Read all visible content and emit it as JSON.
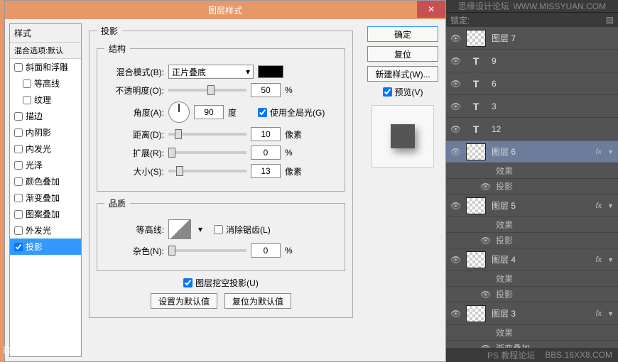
{
  "dialog": {
    "title": "图层样式",
    "close": "✕",
    "styles": {
      "header": "样式",
      "sub": "混合选项:默认",
      "items": [
        {
          "label": "斜面和浮雕",
          "checked": false,
          "indent": false
        },
        {
          "label": "等高线",
          "checked": false,
          "indent": true
        },
        {
          "label": "纹理",
          "checked": false,
          "indent": true
        },
        {
          "label": "描边",
          "checked": false,
          "indent": false
        },
        {
          "label": "内阴影",
          "checked": false,
          "indent": false
        },
        {
          "label": "内发光",
          "checked": false,
          "indent": false
        },
        {
          "label": "光泽",
          "checked": false,
          "indent": false
        },
        {
          "label": "颜色叠加",
          "checked": false,
          "indent": false
        },
        {
          "label": "渐变叠加",
          "checked": false,
          "indent": false
        },
        {
          "label": "图案叠加",
          "checked": false,
          "indent": false
        },
        {
          "label": "外发光",
          "checked": false,
          "indent": false
        },
        {
          "label": "投影",
          "checked": true,
          "indent": false,
          "active": true
        }
      ]
    },
    "section_title": "投影",
    "structure": {
      "legend": "结构",
      "blend_label": "混合模式(B):",
      "blend_value": "正片叠底",
      "opacity_label": "不透明度(O):",
      "opacity_value": "50",
      "opacity_unit": "%",
      "angle_label": "角度(A):",
      "angle_value": "90",
      "angle_unit": "度",
      "global_light": "使用全局光(G)",
      "distance_label": "距离(D):",
      "distance_value": "10",
      "distance_unit": "像素",
      "spread_label": "扩展(R):",
      "spread_value": "0",
      "spread_unit": "%",
      "size_label": "大小(S):",
      "size_value": "13",
      "size_unit": "像素"
    },
    "quality": {
      "legend": "品质",
      "contour_label": "等高线:",
      "antialiased": "消除锯齿(L)",
      "noise_label": "杂色(N):",
      "noise_value": "0",
      "noise_unit": "%"
    },
    "knockout": "图层挖空投影(U)",
    "btn_default": "设置为默认值",
    "btn_reset": "复位为默认值",
    "right": {
      "ok": "确定",
      "cancel": "复位",
      "newstyle": "新建样式(W)...",
      "preview": "预览(V)"
    }
  },
  "panel": {
    "lock_label": "锁定:",
    "forum": "思缘设计论坛",
    "url": "WWW.MISSYUAN.COM",
    "layers": [
      {
        "type": "img",
        "name": "图层 7"
      },
      {
        "type": "text",
        "name": "9"
      },
      {
        "type": "text",
        "name": "6"
      },
      {
        "type": "text",
        "name": "3"
      },
      {
        "type": "text",
        "name": "12"
      },
      {
        "type": "img",
        "name": "图层 6",
        "sel": true,
        "fx": true,
        "sub": [
          "效果",
          "投影"
        ]
      },
      {
        "type": "img",
        "name": "图层 5",
        "fx": true,
        "sub": [
          "效果",
          "投影"
        ]
      },
      {
        "type": "img",
        "name": "图层 4",
        "fx": true,
        "sub": [
          "效果",
          "投影"
        ]
      },
      {
        "type": "img",
        "name": "图层 3",
        "fx": true,
        "sub": [
          "效果",
          "渐变叠加"
        ]
      }
    ],
    "footer_left": "PS 教程论坛",
    "footer_right": "BBS.16XX8.COM"
  },
  "watermark": "Baidu 贴吧"
}
